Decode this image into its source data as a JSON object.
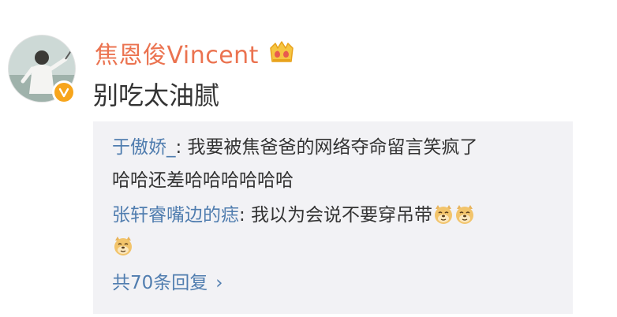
{
  "user": {
    "name": "焦恩俊Vincent",
    "verified_badge_color": "#f7a51c",
    "name_color": "#eb7350"
  },
  "post": {
    "text": "别吃太油腻"
  },
  "replies": [
    {
      "user": "于傲娇_",
      "separator": ":",
      "line1": " 我要被焦爸爸的网络夺命留言笑疯了",
      "line2": "哈哈还差哈哈哈哈哈哈"
    },
    {
      "user": "张轩睿嘴边的痣",
      "separator": ":",
      "line1": " 我以为会说不要穿吊带",
      "emoji_icon": "doge-emoji-icon"
    }
  ],
  "more": {
    "label": "共70条回复",
    "chevron": "›"
  },
  "colors": {
    "link": "#507daf",
    "reply_bg": "#f2f2f5",
    "text": "#333333"
  }
}
